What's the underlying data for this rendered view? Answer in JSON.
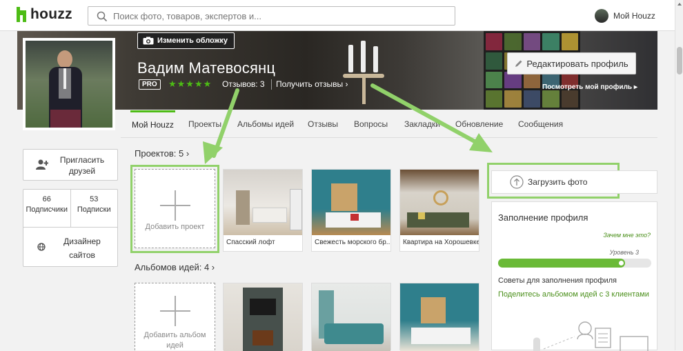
{
  "header": {
    "logo_text": "houzz",
    "search_placeholder": "Поиск фото, товаров, экспертов и...",
    "my_houzz": "Мой Houzz"
  },
  "cover": {
    "change_cover": "Изменить обложку",
    "name": "Вадим Матевосянц",
    "pro_badge": "PRO",
    "stars": "★★★★★",
    "rating": 5,
    "reviews": "Отзывов: 3",
    "get_reviews": "Получить отзывы ›",
    "edit_profile": "Редактировать профиль",
    "view_profile": "Посмотреть мой профиль ▸"
  },
  "tabs": [
    "Мой Houzz",
    "Проекты",
    "Альбомы идей",
    "Отзывы",
    "Вопросы",
    "Закладки",
    "Обновление",
    "Сообщения"
  ],
  "sidebar": {
    "invite": "Пригласить друзей",
    "followers_count": "66",
    "followers_label": "Подписчики",
    "following_count": "53",
    "following_label": "Подписки",
    "designer": "Дизайнер сайтов"
  },
  "projects": {
    "title": "Проектов: 5 ›",
    "add_label": "Добавить проект",
    "items": [
      "Спасский лофт",
      "Свежесть морского бр...",
      "Квартира на Хорошевке"
    ]
  },
  "albums": {
    "title": "Альбомов идей: 4 ›",
    "add_label": "Добавить альбом идей"
  },
  "upload": {
    "label": "Загрузить фото"
  },
  "completion": {
    "title": "Заполнение профиля",
    "why": "Зачем мне это?",
    "level": "Уровень 3",
    "progress": 0.83,
    "tips": "Советы для заполнения профиля",
    "share": "Поделитесь альбомом идей с 3 клиентами"
  },
  "colors": {
    "brand": "#4dbc15",
    "annotation": "#91d16a"
  }
}
